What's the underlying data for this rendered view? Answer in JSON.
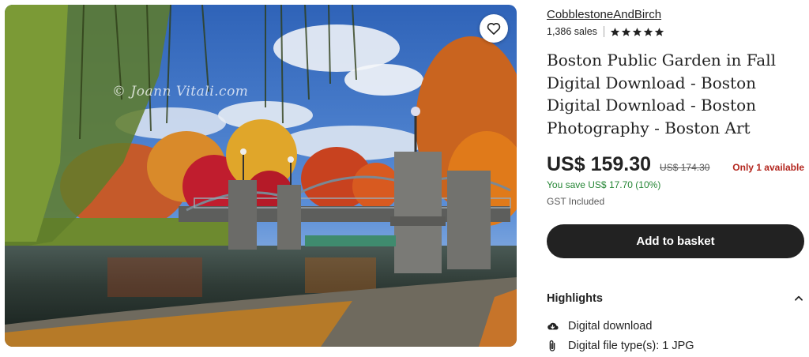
{
  "photo": {
    "watermark": "© Joann Vitali.com",
    "favorite_icon": "heart-icon"
  },
  "shop": {
    "name": "CobblestoneAndBirch",
    "sales": "1,386 sales",
    "rating": 5,
    "rating_icon": "star-icon"
  },
  "listing": {
    "title": "Boston Public Garden in Fall Digital Download - Boston Digital Download - Boston Photography - Boston Art",
    "price": "US$ 159.30",
    "original_price": "US$ 174.30",
    "availability": "Only 1 available",
    "savings": "You save US$ 17.70 (10%)",
    "tax_note": "GST Included",
    "add_to_basket_label": "Add to basket"
  },
  "highlights": {
    "title": "Highlights",
    "toggle_icon": "chevron-up-icon",
    "items": [
      {
        "icon": "cloud-download-icon",
        "label": "Digital download"
      },
      {
        "icon": "paperclip-icon",
        "label": "Digital file type(s): 1 JPG"
      }
    ]
  },
  "colors": {
    "savings_green": "#258635",
    "availability_red": "#b3261e",
    "button_dark": "#222222"
  }
}
